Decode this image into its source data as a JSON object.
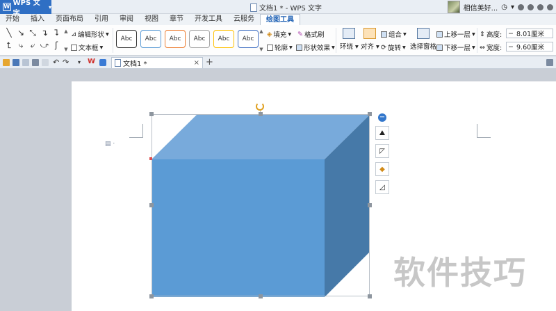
{
  "titlebar": {
    "app_name": "WPS 文字",
    "doc_title": "文档1 * - WPS 文字",
    "user_name": "相信美好..."
  },
  "menu": {
    "tabs": [
      "开始",
      "插入",
      "页面布局",
      "引用",
      "审阅",
      "视图",
      "章节",
      "开发工具",
      "云服务",
      "绘图工具"
    ],
    "active_tab": "绘图工具"
  },
  "ribbon": {
    "edit_shape": "编辑形状",
    "text_box": "文本框",
    "style_label": "Abc",
    "style_colors": [
      "#333333",
      "#5b9bd5",
      "#ed7d31",
      "#a5a5a5",
      "#ffc000",
      "#4472c4"
    ],
    "fill": "填充",
    "format_painter": "格式刷",
    "outline": "轮廓",
    "shape_effect": "形状效果",
    "wrap": "环绕",
    "align": "对齐",
    "group": "组合",
    "rotate": "旋转",
    "selection_pane": "选择窗格",
    "bring_forward": "上移一层",
    "send_backward": "下移一层",
    "height_label": "高度:",
    "height_value": "8.01厘米",
    "width_label": "宽度:",
    "width_value": "9.60厘米",
    "minus": "−",
    "plus": "+"
  },
  "doc_tab": {
    "label": "文档1 *",
    "close": "×",
    "new_tab": "+"
  },
  "canvas": {
    "watermark": "软件技巧",
    "shape": "cube",
    "cube_colors": {
      "front": "#5b9bd5",
      "top": "#78aadb",
      "side": "#4679a8"
    }
  }
}
